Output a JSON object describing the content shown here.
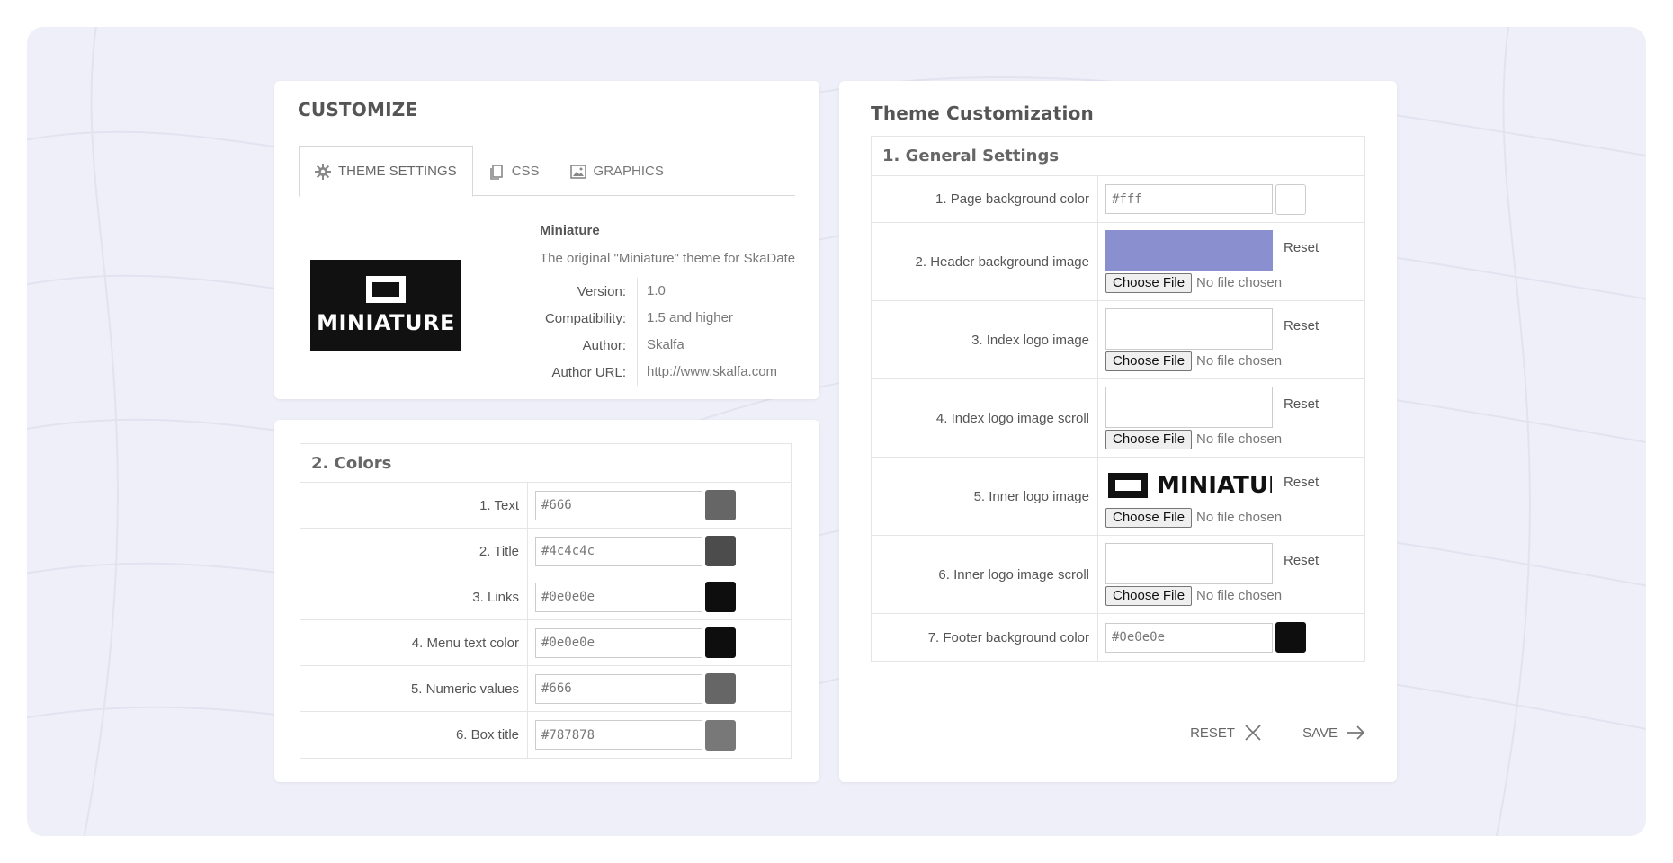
{
  "customize": {
    "title": "CUSTOMIZE",
    "tabs": [
      {
        "label": "THEME SETTINGS",
        "icon": "gear-icon",
        "active": true
      },
      {
        "label": "CSS",
        "icon": "copy-icon",
        "active": false
      },
      {
        "label": "GRAPHICS",
        "icon": "image-icon",
        "active": false
      }
    ],
    "theme": {
      "logo_text": "MINIATURE",
      "name": "Miniature",
      "description": "The original \"Miniature\" theme for SkaDate",
      "meta": [
        {
          "label": "Version:",
          "value": "1.0"
        },
        {
          "label": "Compatibility:",
          "value": "1.5 and higher"
        },
        {
          "label": "Author:",
          "value": "Skalfa"
        },
        {
          "label": "Author URL:",
          "value": "http://www.skalfa.com"
        }
      ]
    }
  },
  "colors": {
    "heading": "2. Colors",
    "rows": [
      {
        "label": "1. Text",
        "value": "#666",
        "swatch": "#666666"
      },
      {
        "label": "2. Title",
        "value": "#4c4c4c",
        "swatch": "#4c4c4c"
      },
      {
        "label": "3. Links",
        "value": "#0e0e0e",
        "swatch": "#0e0e0e"
      },
      {
        "label": "4. Menu text color",
        "value": "#0e0e0e",
        "swatch": "#0e0e0e"
      },
      {
        "label": "5. Numeric values",
        "value": "#666",
        "swatch": "#666666"
      },
      {
        "label": "6. Box title",
        "value": "#787878",
        "swatch": "#787878"
      }
    ]
  },
  "theme_customization": {
    "title": "Theme Customization",
    "general_heading": "1. General Settings",
    "page_bg": {
      "label": "1. Page background color",
      "value": "#fff",
      "swatch": "#ffffff"
    },
    "file_rows": [
      {
        "label": "2. Header background image",
        "preview": "filled",
        "preview_color": "#8a8fd0"
      },
      {
        "label": "3. Index logo image",
        "preview": "empty"
      },
      {
        "label": "4. Index logo image scroll",
        "preview": "empty"
      },
      {
        "label": "5. Inner logo image",
        "preview": "logo",
        "logo_text": "MINIATURE"
      },
      {
        "label": "6. Inner logo image scroll",
        "preview": "empty"
      }
    ],
    "reset_label": "Reset",
    "choose_file_label": "Choose File",
    "no_file_label": "No file chosen",
    "footer_bg": {
      "label": "7. Footer background color",
      "value": "#0e0e0e",
      "swatch": "#0e0e0e"
    },
    "actions": {
      "reset": "RESET",
      "save": "SAVE"
    }
  }
}
